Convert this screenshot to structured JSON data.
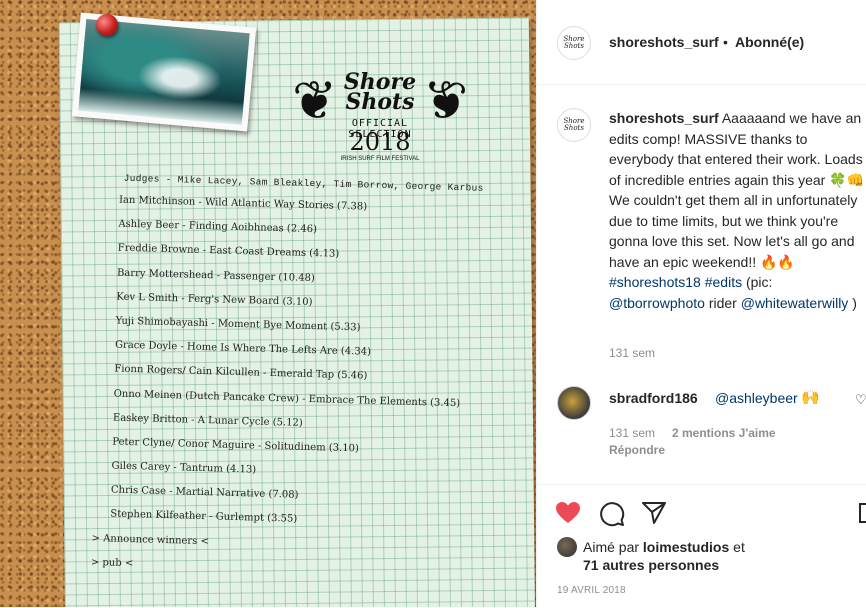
{
  "photo": {
    "logo_title": "Shore Shots",
    "logo_sub": "OFFICIAL SELECTION",
    "logo_year": "2018",
    "logo_fest": "IRISH SURF FILM FESTIVAL",
    "list": [
      "Judges - Mike Lacey, Sam Bleakley, Tim Borrow, George Karbus",
      "Ian Mitchinson - Wild Atlantic Way Stories (7.38)",
      "Ashley Beer - Finding Aoibhneas (2.46)",
      "Freddie Browne - East Coast Dreams (4.13)",
      "Barry Mottershead - Passenger (10.48)",
      "Kev L Smith - Ferg's New Board (3.10)",
      "Yuji Shimobayashi - Moment Bye Moment (5.33)",
      "Grace Doyle - Home Is Where The Lefts Are (4.34)",
      "Fionn Rogers/ Cain Kilcullen - Emerald Tap (5.46)",
      "Onno Meinen (Dutch Pancake Crew) - Embrace The Elements (3.45)",
      "Easkey Britton - A Lunar Cycle (5.12)",
      "Peter Clyne/ Conor Maguire - Solitudinem (3.10)",
      "Giles Carey - Tantrum (4.13)",
      "Chris Case - Martial Narrative (7.08)",
      "Stephen Kilfeather - Gurlempt (3.55)",
      "> Announce winners <",
      "> pub <"
    ]
  },
  "header": {
    "username": "shoreshots_surf",
    "dot": "•",
    "follow_status": "Abonné(e)"
  },
  "caption": {
    "username": "shoreshots_surf",
    "text_part1": "Aaaaaand we have an edits comp! MASSIVE thanks to everybody that entered their work. Loads of incredible entries again this year",
    "emoji1": "🍀👊",
    "text_part2": "We couldn't get them all in unfortunately due to time limits, but we think you're gonna love this set. Now let's all go and have an epic weekend!!",
    "emoji2": "🔥🔥",
    "hashtags": "#shoreshots18 #edits",
    "pic_prefix": "(pic: ",
    "pic_mention": "@tborrowphoto",
    "rider_text": " rider ",
    "rider_mention": "@whitewaterwilly",
    "pic_suffix": " )",
    "time": "131 sem"
  },
  "comment": {
    "username": "sbradford186",
    "mention": "@ashleybeer",
    "emoji": "🙌",
    "time": "131 sem",
    "likes": "2 mentions J'aime",
    "reply": "Répondre"
  },
  "actions": {
    "liked_by_prefix": "Aimé par",
    "liked_by_user": "loimestudios",
    "liked_by_suffix": "et",
    "liked_others": "71 autres personnes",
    "date": "19 AVRIL 2018"
  },
  "icons": {
    "heart_color": "#ed4956",
    "text_color": "#262626",
    "link_color": "#00376b",
    "muted_color": "#8e8e8e"
  }
}
